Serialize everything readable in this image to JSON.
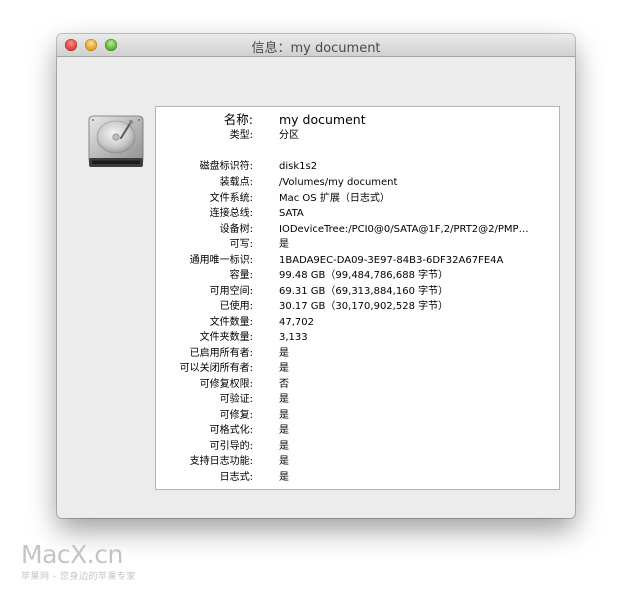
{
  "window": {
    "title": "信息：my document"
  },
  "icon": "hard-drive-icon",
  "info": {
    "rows": [
      {
        "label": "名称:",
        "value": "my document"
      },
      {
        "label": "类型:",
        "value": "分区"
      },
      {
        "label": "磁盘标识符:",
        "value": "disk1s2"
      },
      {
        "label": "装载点:",
        "value": "/Volumes/my document"
      },
      {
        "label": "文件系统:",
        "value": "Mac OS 扩展（日志式）"
      },
      {
        "label": "连接总线:",
        "value": "SATA"
      },
      {
        "label": "设备树:",
        "value": "IODeviceTree:/PCI0@0/SATA@1F,2/PRT2@2/PMP…"
      },
      {
        "label": "可写:",
        "value": "是"
      },
      {
        "label": "通用唯一标识:",
        "value": "1BADA9EC-DA09-3E97-84B3-6DF32A67FE4A"
      },
      {
        "label": "容量:",
        "value": "99.48 GB（99,484,786,688 字节）"
      },
      {
        "label": "可用空间:",
        "value": "69.31 GB（69,313,884,160 字节）"
      },
      {
        "label": "已使用:",
        "value": "30.17 GB（30,170,902,528 字节）"
      },
      {
        "label": "文件数量:",
        "value": "47,702"
      },
      {
        "label": "文件夹数量:",
        "value": "3,133"
      },
      {
        "label": "已启用所有者:",
        "value": "是"
      },
      {
        "label": "可以关闭所有者:",
        "value": "是"
      },
      {
        "label": "可修复权限:",
        "value": "否"
      },
      {
        "label": "可验证:",
        "value": "是"
      },
      {
        "label": "可修复:",
        "value": "是"
      },
      {
        "label": "可格式化:",
        "value": "是"
      },
      {
        "label": "可引导的:",
        "value": "是"
      },
      {
        "label": "支持日志功能:",
        "value": "是"
      },
      {
        "label": "日志式:",
        "value": "是"
      }
    ]
  },
  "watermark": {
    "logo": "MacX.cn",
    "tagline": "苹果网 - 您身边的苹果专家"
  }
}
